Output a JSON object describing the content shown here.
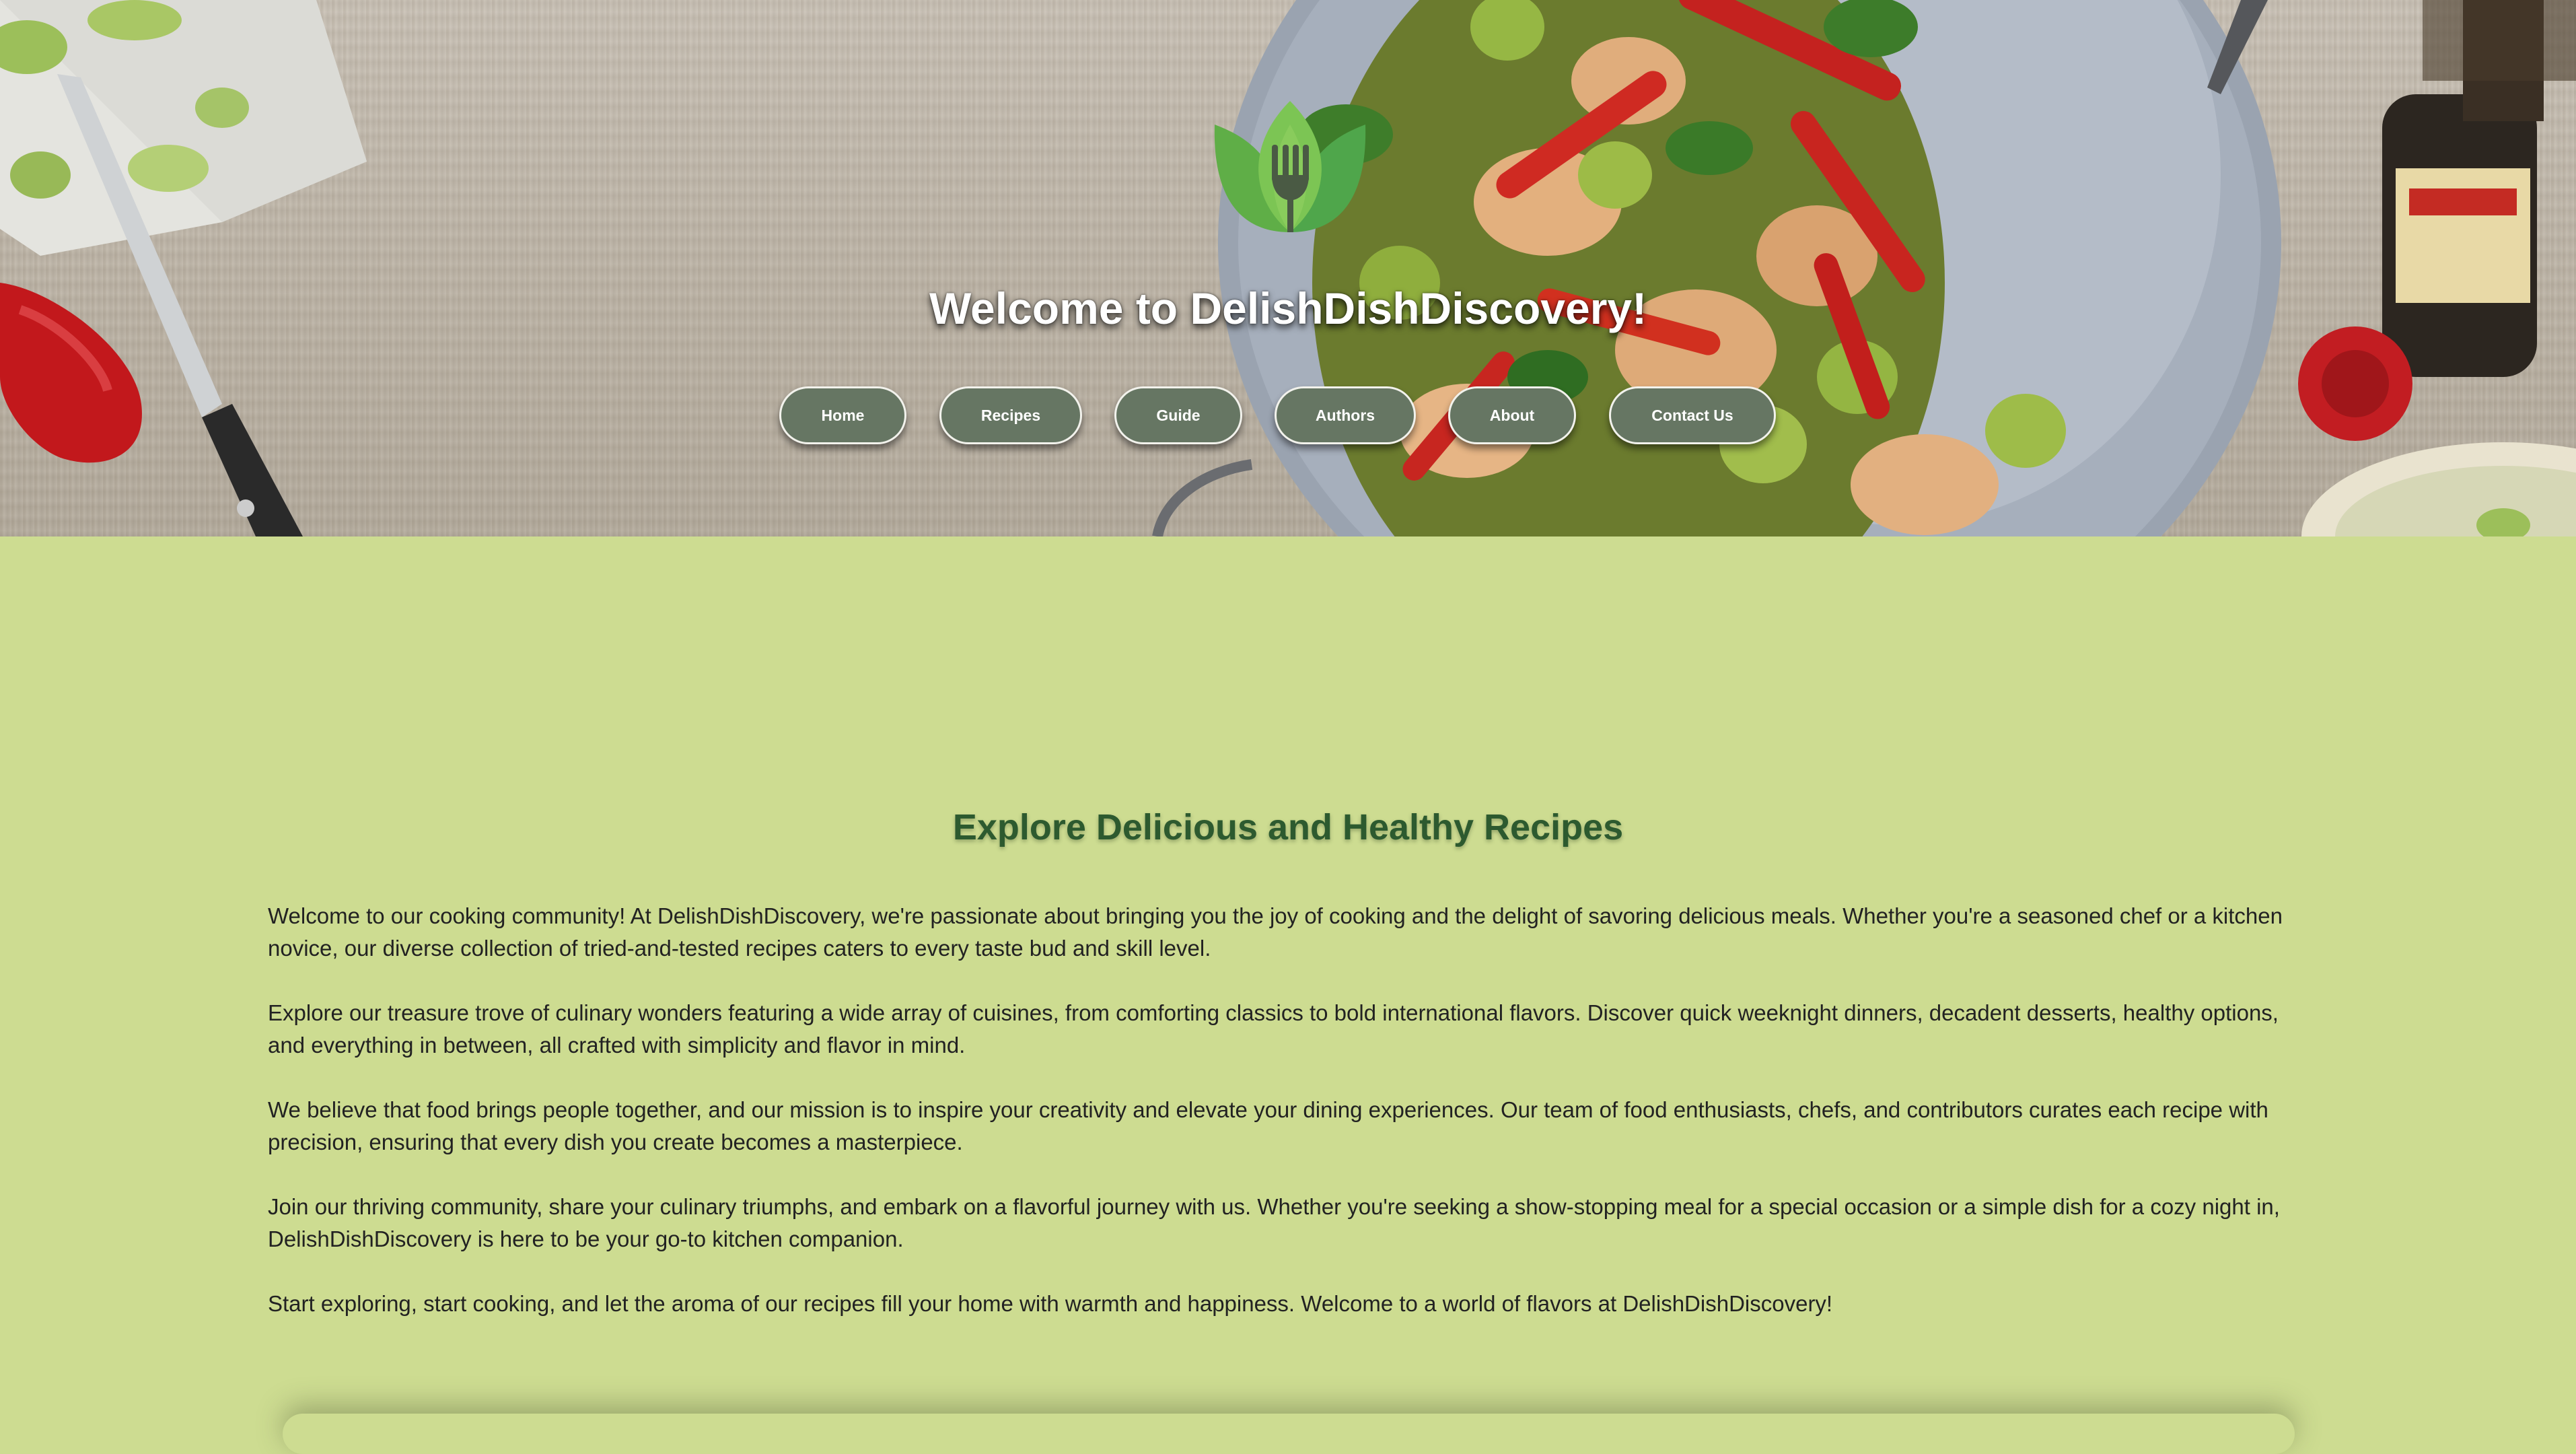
{
  "hero": {
    "title": "Welcome to DelishDishDiscovery!",
    "logo_icon": "leaf-fork-logo-icon"
  },
  "nav": {
    "items": [
      {
        "label": "Home"
      },
      {
        "label": "Recipes"
      },
      {
        "label": "Guide"
      },
      {
        "label": "Authors"
      },
      {
        "label": "About"
      },
      {
        "label": "Contact Us"
      }
    ]
  },
  "main": {
    "heading": "Explore Delicious and Healthy Recipes",
    "paragraphs": [
      "Welcome to our cooking community! At DelishDishDiscovery, we're passionate about bringing you the joy of cooking and the delight of savoring delicious meals. Whether you're a seasoned chef or a kitchen novice, our diverse collection of tried-and-tested recipes caters to every taste bud and skill level.",
      "Explore our treasure trove of culinary wonders featuring a wide array of cuisines, from comforting classics to bold international flavors. Discover quick weeknight dinners, decadent desserts, healthy options, and everything in between, all crafted with simplicity and flavor in mind.",
      "We believe that food brings people together, and our mission is to inspire your creativity and elevate your dining experiences. Our team of food enthusiasts, chefs, and contributors curates each recipe with precision, ensuring that every dish you create becomes a masterpiece.",
      "Join our thriving community, share your culinary triumphs, and embark on a flavorful journey with us. Whether you're seeking a show-stopping meal for a special occasion or a simple dish for a cozy night in, DelishDishDiscovery is here to be your go-to kitchen companion.",
      "Start exploring, start cooking, and let the aroma of our recipes fill your home with warmth and happiness. Welcome to a world of flavors at DelishDishDiscovery!"
    ]
  },
  "colors": {
    "page_background": "#cddc91",
    "nav_button": "#667663",
    "heading": "#2d5a2f"
  }
}
